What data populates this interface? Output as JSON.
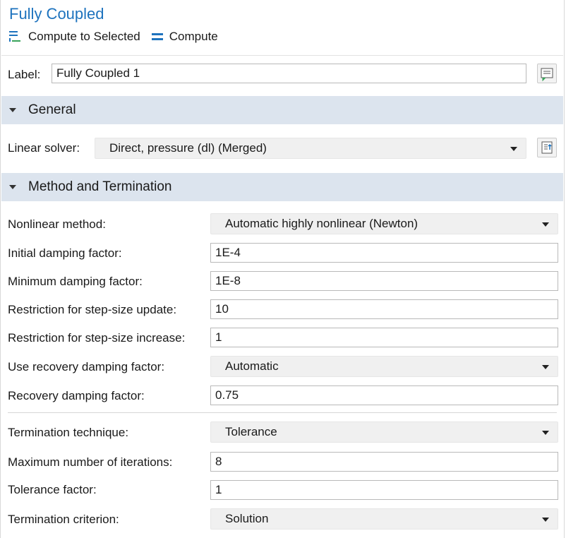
{
  "header": {
    "title": "Fully Coupled"
  },
  "toolbar": {
    "compute_selected": "Compute to Selected",
    "compute": "Compute"
  },
  "label_row": {
    "label": "Label:",
    "value": "Fully Coupled 1"
  },
  "general": {
    "title": "General",
    "linear_solver_label": "Linear solver:",
    "linear_solver_value": "Direct, pressure (dl) (Merged)"
  },
  "method": {
    "title": "Method and Termination",
    "rows": {
      "nonlinear_method": {
        "label": "Nonlinear method:",
        "value": "Automatic highly nonlinear (Newton)"
      },
      "initial_damping": {
        "label": "Initial damping factor:",
        "value": "1E-4"
      },
      "minimum_damping": {
        "label": "Minimum damping factor:",
        "value": "1E-8"
      },
      "restriction_update": {
        "label": "Restriction for step-size update:",
        "value": "10"
      },
      "restriction_increase": {
        "label": "Restriction for step-size increase:",
        "value": "1"
      },
      "use_recovery": {
        "label": "Use recovery damping factor:",
        "value": "Automatic"
      },
      "recovery_factor": {
        "label": "Recovery damping factor:",
        "value": "0.75"
      },
      "termination_technique": {
        "label": "Termination technique:",
        "value": "Tolerance"
      },
      "max_iterations": {
        "label": "Maximum number of iterations:",
        "value": "8"
      },
      "tolerance_factor": {
        "label": "Tolerance factor:",
        "value": "1"
      },
      "termination_criterion": {
        "label": "Termination criterion:",
        "value": "Solution"
      }
    }
  },
  "colors": {
    "accent": "#1e73be",
    "section_bg": "#dce4ee"
  }
}
